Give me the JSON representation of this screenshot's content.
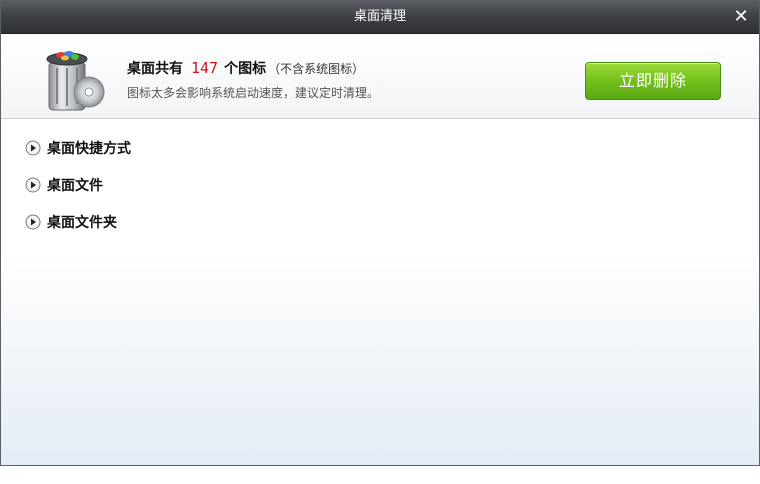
{
  "window": {
    "title": "桌面清理"
  },
  "header": {
    "prefix": "桌面共有",
    "count": "147",
    "suffix": "个图标",
    "note": "（不含系统图标）",
    "description": "图标太多会影响系统启动速度，建议定时清理。",
    "delete_label": "立即删除"
  },
  "categories": [
    {
      "label": "桌面快捷方式"
    },
    {
      "label": "桌面文件"
    },
    {
      "label": "桌面文件夹"
    }
  ],
  "colors": {
    "count": "#c8161d",
    "button": "#72bf1c",
    "titlebar": "#3d4045"
  }
}
